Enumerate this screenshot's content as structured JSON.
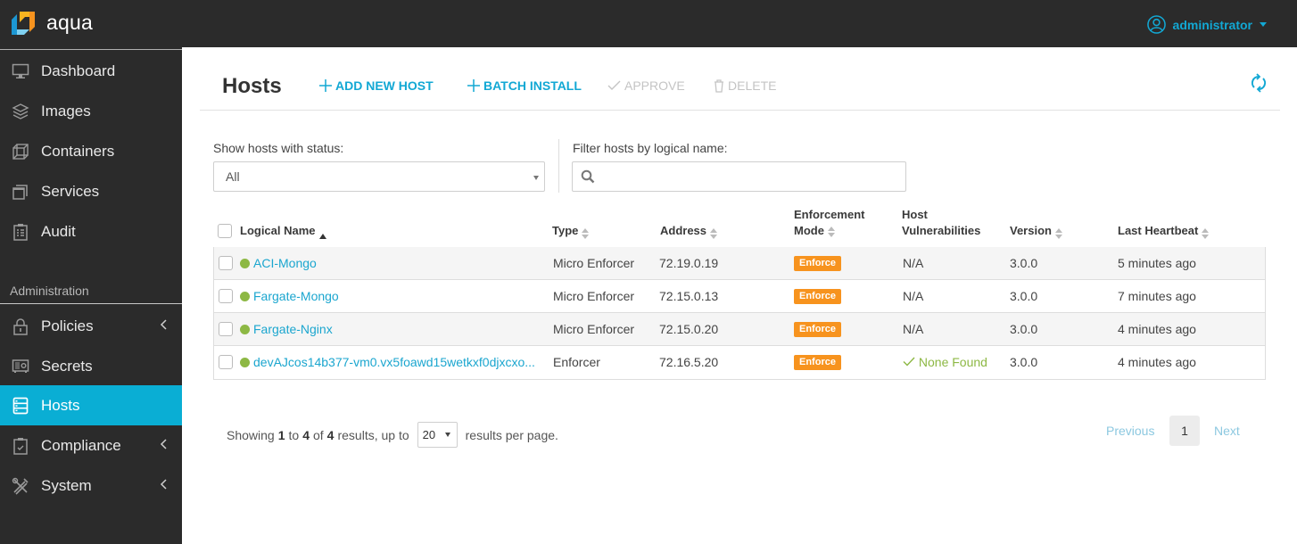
{
  "app": {
    "name": "aqua",
    "user": "administrator",
    "colors": {
      "accent": "#0aaed4",
      "link": "#1ba6cf",
      "enforce_badge": "#f7931e",
      "status_ok": "#8db844",
      "sidebar_bg": "#2b2b2b"
    }
  },
  "sidebar": {
    "items": [
      {
        "label": "Dashboard",
        "icon": "monitor-icon"
      },
      {
        "label": "Images",
        "icon": "layers-icon"
      },
      {
        "label": "Containers",
        "icon": "cube-icon"
      },
      {
        "label": "Services",
        "icon": "stacked-windows-icon"
      },
      {
        "label": "Audit",
        "icon": "clipboard-list-icon"
      }
    ],
    "section_label": "Administration",
    "admin_items": [
      {
        "label": "Policies",
        "icon": "lock-icon",
        "expandable": true
      },
      {
        "label": "Secrets",
        "icon": "safe-icon",
        "expandable": false
      },
      {
        "label": "Hosts",
        "icon": "server-icon",
        "expandable": false,
        "active": true
      },
      {
        "label": "Compliance",
        "icon": "clipboard-check-icon",
        "expandable": true
      },
      {
        "label": "System",
        "icon": "tools-icon",
        "expandable": true
      }
    ]
  },
  "header": {
    "title": "Hosts",
    "actions": {
      "add_new_host": "ADD NEW HOST",
      "batch_install": "BATCH INSTALL",
      "approve": "APPROVE",
      "delete": "DELETE"
    }
  },
  "filters": {
    "status_label": "Show hosts with status:",
    "status_value": "All",
    "name_label": "Filter hosts by logical name:",
    "name_value": "",
    "name_placeholder": ""
  },
  "table": {
    "columns": {
      "logical_name": "Logical Name",
      "type": "Type",
      "address": "Address",
      "enforcement_mode_1": "Enforcement",
      "enforcement_mode_2": "Mode",
      "host_vuln_1": "Host",
      "host_vuln_2": "Vulnerabilities",
      "version": "Version",
      "last_heartbeat": "Last Heartbeat"
    },
    "rows": [
      {
        "name": "ACI-Mongo",
        "type": "Micro Enforcer",
        "address": "72.19.0.19",
        "mode": "Enforce",
        "vulnerabilities": "N/A",
        "version": "3.0.0",
        "heartbeat": "5 minutes ago"
      },
      {
        "name": "Fargate-Mongo",
        "type": "Micro Enforcer",
        "address": "72.15.0.13",
        "mode": "Enforce",
        "vulnerabilities": "N/A",
        "version": "3.0.0",
        "heartbeat": "7 minutes ago"
      },
      {
        "name": "Fargate-Nginx",
        "type": "Micro Enforcer",
        "address": "72.15.0.20",
        "mode": "Enforce",
        "vulnerabilities": "N/A",
        "version": "3.0.0",
        "heartbeat": "4 minutes ago"
      },
      {
        "name": "devAJcos14b377-vm0.vx5foawd15wetkxf0djxcxo...",
        "type": "Enforcer",
        "address": "72.16.5.20",
        "mode": "Enforce",
        "vulnerabilities": "None Found",
        "version": "3.0.0",
        "heartbeat": "4 minutes ago"
      }
    ]
  },
  "pagination": {
    "showing": "Showing",
    "from": "1",
    "to_word": "to",
    "to": "4",
    "of_word": "of",
    "total": "4",
    "results_up_to": "results, up to",
    "per_page": "20",
    "per_page_suffix": "results per page.",
    "previous": "Previous",
    "current_page": "1",
    "next": "Next"
  }
}
